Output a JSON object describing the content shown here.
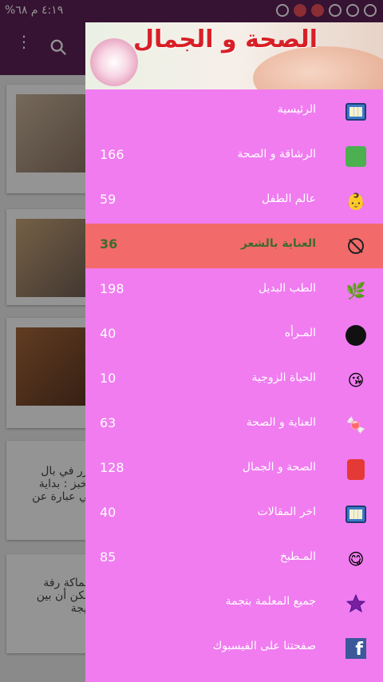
{
  "status_bar": {
    "time": "٤:١٩ م",
    "battery": "٦٨%"
  },
  "drawer": {
    "banner_title": "الصحة و الجمال",
    "items": [
      {
        "label": "الرئيسية",
        "count": "",
        "icon": "tv-icon"
      },
      {
        "label": "الرشاقة و الصحة",
        "count": "166",
        "icon": "weight-scale-icon"
      },
      {
        "label": "عالم الطفل",
        "count": "59",
        "icon": "baby-icon"
      },
      {
        "label": "العناية بالشعر",
        "count": "36",
        "icon": "hair-icon",
        "active": true
      },
      {
        "label": "الطب البديل",
        "count": "198",
        "icon": "herbal-icon"
      },
      {
        "label": "المـرأه",
        "count": "40",
        "icon": "woman-icon"
      },
      {
        "label": "الحياة الزوجية",
        "count": "10",
        "icon": "couple-icon"
      },
      {
        "label": "العناية و الصحة",
        "count": "63",
        "icon": "candy-icon"
      },
      {
        "label": "الصحة و الجمال",
        "count": "128",
        "icon": "beauty-icon"
      },
      {
        "label": "اخر المقالات",
        "count": "40",
        "icon": "tv-icon"
      },
      {
        "label": "المـطبخ",
        "count": "85",
        "icon": "food-icon"
      },
      {
        "label": "جميع المعلمة بنجمة",
        "count": "",
        "icon": "star-icon"
      },
      {
        "label": "صفحتنا على الفيسبوك",
        "count": "",
        "icon": "facebook-icon"
      }
    ]
  },
  "background": {
    "snippet_1": "كرر في بال الخبز : بداية هي عبارة عن",
    "snippet_2": "سماكة رفة يمكن أن بين لتيجة"
  },
  "colors": {
    "drawer_bg": "#f07cf0",
    "active_item_bg": "#f36a6a",
    "toolbar": "#5e1f58"
  }
}
